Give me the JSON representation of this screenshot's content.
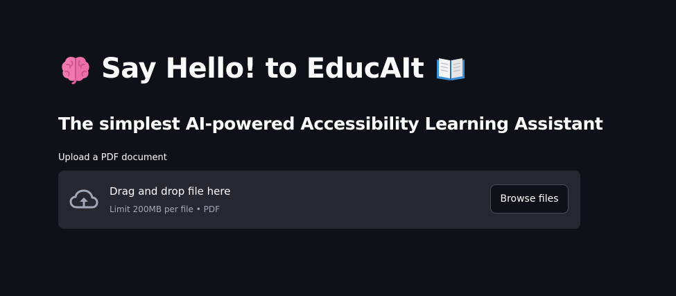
{
  "header": {
    "title": "Say Hello! to EducAIt",
    "leading_icon": "brain-emoji-icon",
    "trailing_icon": "open-book-emoji-icon",
    "subtitle": "The simplest AI-powered Accessibility Learning Assistant"
  },
  "uploader": {
    "label": "Upload a PDF document",
    "dropzone_text": "Drag and drop file here",
    "limit_text": "Limit 200MB per file • PDF",
    "browse_label": "Browse files",
    "icon": "cloud-upload-icon"
  },
  "colors": {
    "background": "#0e1117",
    "dropzone_bg": "#262730",
    "text": "#fafafa",
    "muted_text": "#a3a8b8",
    "brain_pink": "#f07ab0"
  }
}
